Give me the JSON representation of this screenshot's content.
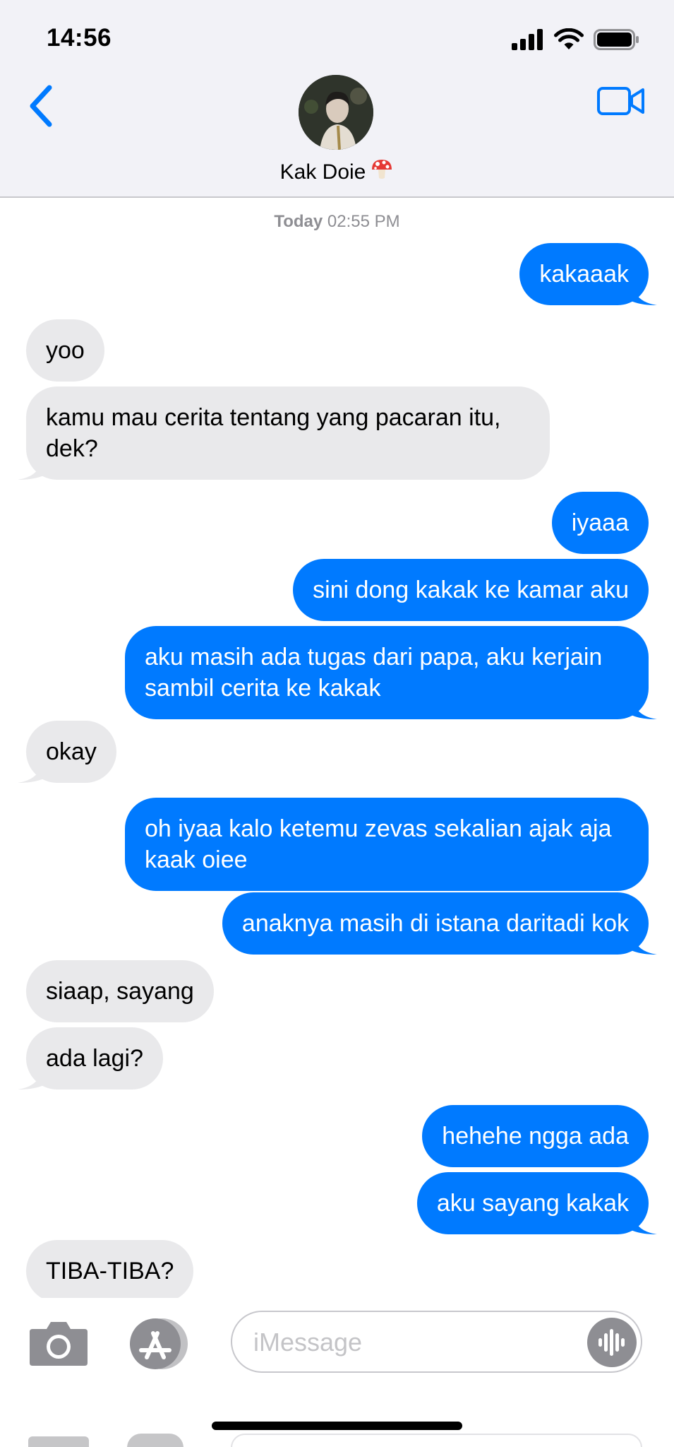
{
  "status_bar": {
    "time": "14:56"
  },
  "header": {
    "contact_name": "Kak Doie",
    "contact_emoji": "🍄",
    "back_icon": "chevron-left-icon",
    "video_icon": "video-camera-icon",
    "accent_color": "#007aff"
  },
  "thread": {
    "timestamp_day": "Today",
    "timestamp_time": "02:55 PM",
    "messages": [
      {
        "from": "me",
        "text": "kakaaak"
      },
      {
        "from": "them",
        "text": "yoo"
      },
      {
        "from": "them",
        "text": "kamu mau cerita tentang yang pacaran itu, dek?"
      },
      {
        "from": "me",
        "text": "iyaaa"
      },
      {
        "from": "me",
        "text": "sini dong kakak ke kamar aku"
      },
      {
        "from": "me",
        "text": "aku masih ada tugas dari papa, aku kerjain sambil cerita ke kakak"
      },
      {
        "from": "them",
        "text": "okay"
      },
      {
        "from": "me",
        "text": "oh iyaa kalo ketemu zevas sekalian ajak aja kaak oiee"
      },
      {
        "from": "me",
        "text": "anaknya masih di istana daritadi kok"
      },
      {
        "from": "them",
        "text": "siaap, sayang"
      },
      {
        "from": "them",
        "text": "ada lagi?"
      },
      {
        "from": "me",
        "text": "hehehe ngga ada"
      },
      {
        "from": "me",
        "text": "aku sayang kakak"
      },
      {
        "from": "them",
        "text": "TIBA-TIBA?"
      }
    ],
    "sent_color": "#007aff",
    "received_color": "#e9e9eb"
  },
  "compose": {
    "placeholder": "iMessage",
    "camera_icon": "camera-icon",
    "appstore_icon": "app-store-icon",
    "audio_icon": "audio-waveform-icon"
  }
}
